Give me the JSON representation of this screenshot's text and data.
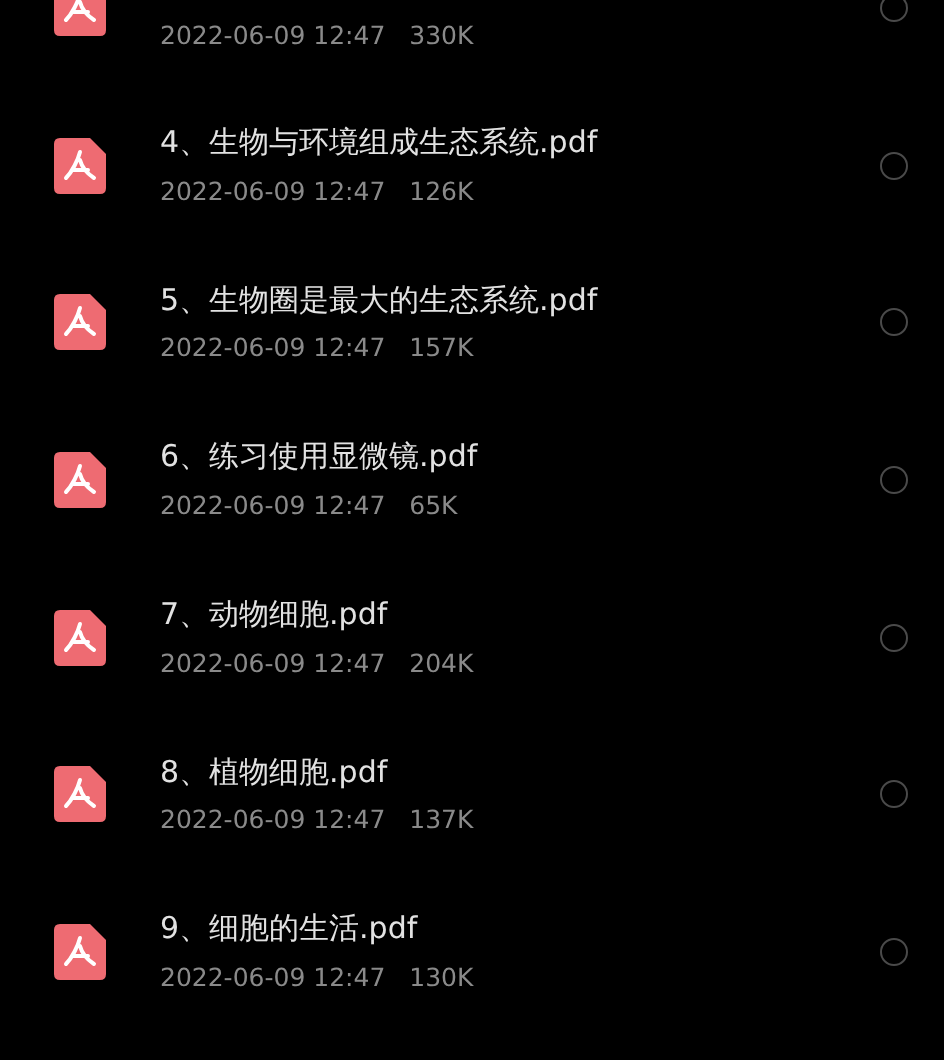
{
  "files": [
    {
      "meta": "2022-06-09 12:47",
      "size": "330K",
      "selected": false
    },
    {
      "name": "4、生物与环境组成生态系统.pdf",
      "meta": "2022-06-09 12:47",
      "size": "126K",
      "selected": false
    },
    {
      "name": "5、生物圈是最大的生态系统.pdf",
      "meta": "2022-06-09 12:47",
      "size": "157K",
      "selected": false
    },
    {
      "name": "6、练习使用显微镜.pdf",
      "meta": "2022-06-09 12:47",
      "size": "65K",
      "selected": false
    },
    {
      "name": "7、动物细胞.pdf",
      "meta": "2022-06-09 12:47",
      "size": "204K",
      "selected": false
    },
    {
      "name": "8、植物细胞.pdf",
      "meta": "2022-06-09 12:47",
      "size": "137K",
      "selected": false
    },
    {
      "name": "9、细胞的生活.pdf",
      "meta": "2022-06-09 12:47",
      "size": "130K",
      "selected": false
    }
  ]
}
